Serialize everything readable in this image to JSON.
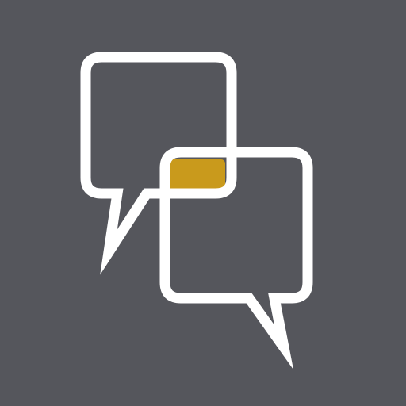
{
  "icon": {
    "name": "chat-bubbles-icon",
    "colors": {
      "background": "#55565c",
      "outline": "#ffffff",
      "overlap_accent": "#c99a1c"
    }
  }
}
